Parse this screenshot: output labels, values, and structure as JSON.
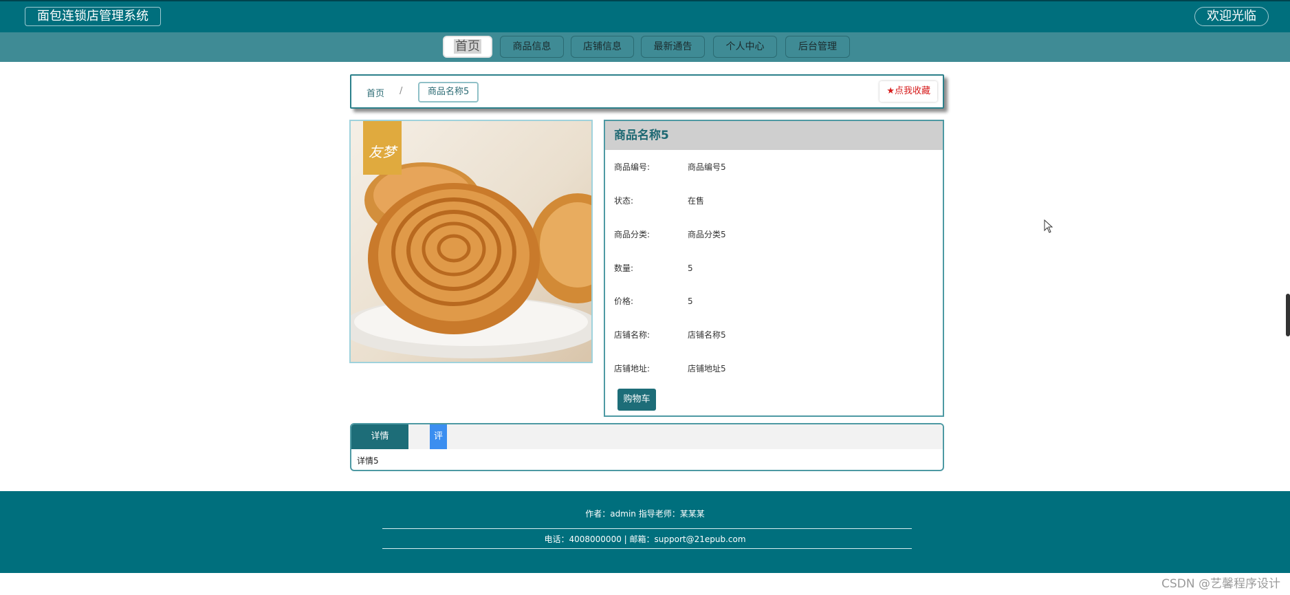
{
  "header": {
    "site_title": "面包连锁店管理系统",
    "welcome": "欢迎光临"
  },
  "nav": {
    "items": [
      {
        "label": "首页",
        "active": true
      },
      {
        "label": "商品信息"
      },
      {
        "label": "店铺信息"
      },
      {
        "label": "最新通告"
      },
      {
        "label": "个人中心"
      },
      {
        "label": "后台管理"
      }
    ]
  },
  "breadcrumb": {
    "home": "首页",
    "separator": "/",
    "current": "商品名称5",
    "favorite_label": "点我收藏",
    "favorite_icon": "star-icon"
  },
  "product": {
    "image_brand": "友梦",
    "name": "商品名称5",
    "fields": [
      {
        "label": "商品编号:",
        "value": "商品编号5"
      },
      {
        "label": "状态:",
        "value": "在售"
      },
      {
        "label": "商品分类:",
        "value": "商品分类5"
      },
      {
        "label": "数量:",
        "value": "5"
      },
      {
        "label": "价格:",
        "value": "5"
      },
      {
        "label": "店铺名称:",
        "value": "店铺名称5"
      },
      {
        "label": "店铺地址:",
        "value": "店铺地址5"
      }
    ],
    "cart_button": "购物车"
  },
  "tabs": {
    "detail_label": "详情",
    "comment_label": "评论",
    "content": "详情5"
  },
  "footer": {
    "line1": "作者：admin 指导老师：某某某",
    "line2": "电话：4008000000 | 邮箱：support@21epub.com"
  },
  "watermark": "CSDN @艺馨程序设计",
  "colors": {
    "primary": "#006f7d",
    "nav": "#3f8b95",
    "accent_blue": "#3b8ef0",
    "favorite_red": "#d61a1a"
  }
}
